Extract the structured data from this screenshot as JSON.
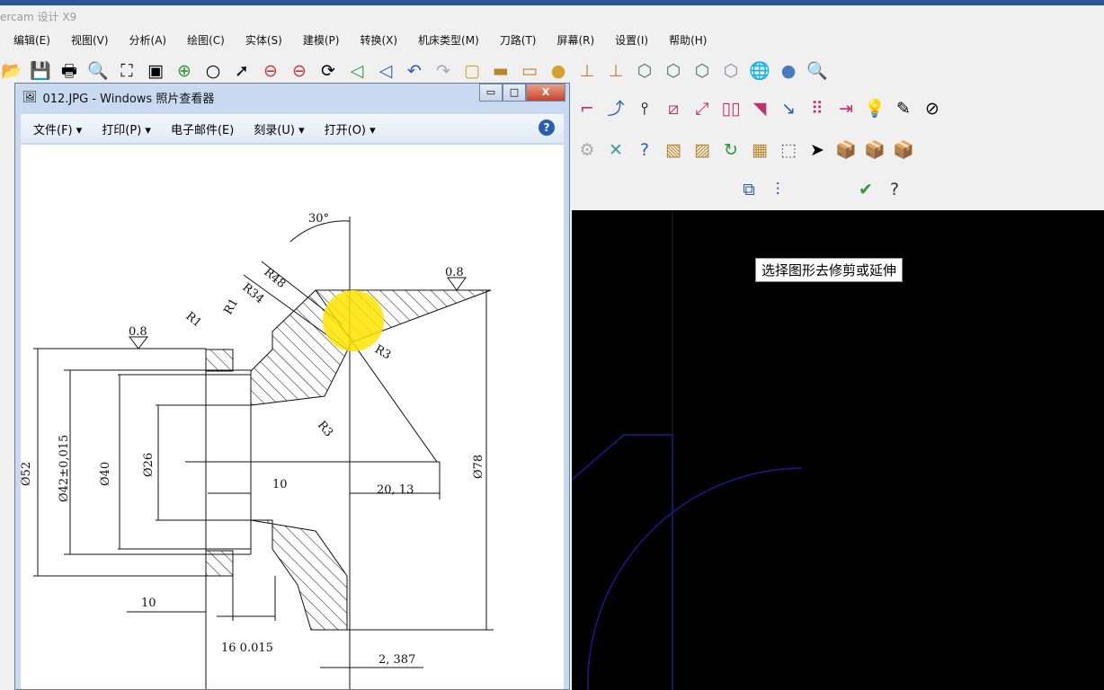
{
  "app": {
    "title": "ercam 设计 X9"
  },
  "menu": [
    "编辑(E)",
    "视图(V)",
    "分析(A)",
    "绘图(C)",
    "实体(S)",
    "建模(P)",
    "转换(X)",
    "机床类型(M)",
    "刀路(T)",
    "屏幕(R)",
    "设置(I)",
    "帮助(H)"
  ],
  "cad": {
    "prompt": "选择图形去修剪或延伸",
    "curve_color": "#1a1a8c"
  },
  "viewer": {
    "title": "012.JPG - Windows 照片查看器",
    "menu": [
      "文件(F) ▾",
      "打印(P) ▾",
      "电子邮件(E)",
      "刻录(U) ▾",
      "打开(O) ▾"
    ],
    "help_label": "?",
    "buttons": {
      "minimize": "▭",
      "maximize": "□",
      "close": "X"
    },
    "drawing": {
      "angle": "30°",
      "r48": "R48",
      "r34": "R34",
      "r1a": "R1",
      "r1b": "R1",
      "r3a": "R3",
      "r3b": "R3",
      "rough_left": "0.8",
      "rough_right": "0.8",
      "d42": "Ø42±0,015",
      "d40": "Ø40",
      "d52": "Ø52",
      "d26": "Ø26",
      "d78": "Ø78",
      "w10a": "10",
      "w10b": "10",
      "w16": "16 0.015",
      "dim2013": "20, 13",
      "dim2387": "2, 387"
    }
  }
}
